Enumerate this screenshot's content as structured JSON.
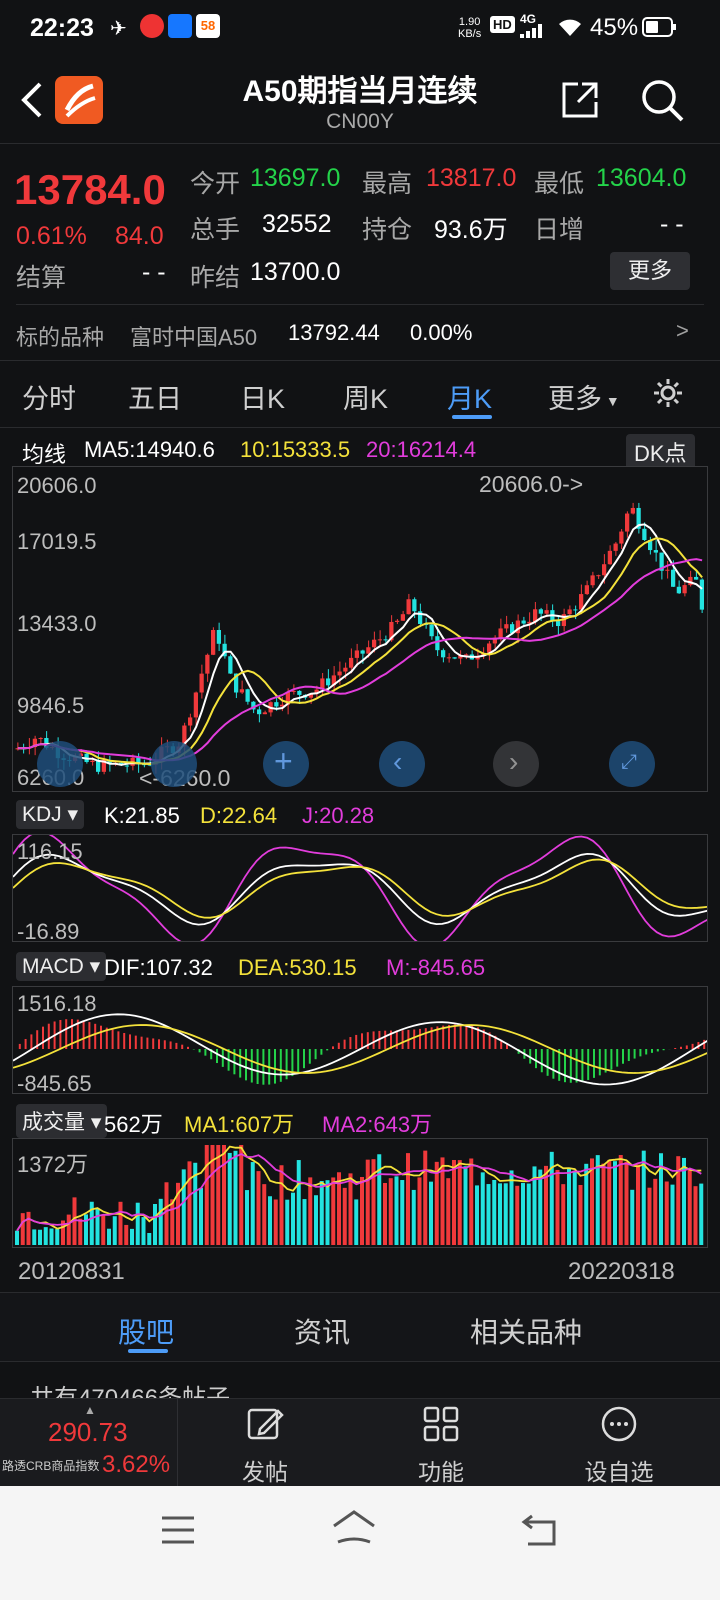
{
  "status": {
    "time": "22:23",
    "net_speed_top": "1.90",
    "net_speed_bottom": "KB/s",
    "hd": "HD",
    "signal": "4G",
    "battery": "45%",
    "app_badge": "58"
  },
  "header": {
    "title": "A50期指当月连续",
    "code": "CN00Y"
  },
  "quote": {
    "price": "13784.0",
    "change_pct": "0.61%",
    "change": "84.0",
    "open_label": "今开",
    "open": "13697.0",
    "high_label": "最高",
    "high": "13817.0",
    "low_label": "最低",
    "low": "13604.0",
    "volume_label": "总手",
    "volume": "32552",
    "oi_label": "持仓",
    "oi": "93.6万",
    "daily_inc_label": "日增",
    "daily_inc": "- -",
    "settle_label": "结算",
    "settle": "- -",
    "prev_settle_label": "昨结",
    "prev_settle": "13700.0",
    "more_button": "更多",
    "underlying_label": "标的品种",
    "underlying_name": "富时中国A50",
    "underlying_price": "13792.44",
    "underlying_pct": "0.00%"
  },
  "period_tabs": [
    "分时",
    "五日",
    "日K",
    "周K",
    "月K",
    "更多"
  ],
  "active_period": "月K",
  "kline": {
    "ma_label": "均线",
    "ma5": "MA5:14940.6",
    "ma10": "10:15333.5",
    "ma20": "20:16214.4",
    "dk_button": "DK点",
    "y_labels": [
      "20606.0",
      "17019.5",
      "13433.0",
      "9846.5",
      "6260.0"
    ],
    "high_marker": "20606.0->",
    "low_marker": "<-6260.0",
    "colors": {
      "up": "#f0393b",
      "down": "#23e3e0",
      "ma5": "#ffffff",
      "ma10": "#f4e23b",
      "ma20": "#e23ddc"
    }
  },
  "kdj": {
    "label": "KDJ",
    "k": "K:21.85",
    "d": "D:22.64",
    "j": "J:20.28",
    "y_top": "116.15",
    "y_bottom": "-16.89"
  },
  "macd": {
    "label": "MACD",
    "dif": "DIF:107.32",
    "dea": "DEA:530.15",
    "m": "M:-845.65",
    "y_top": "1516.18",
    "y_bottom": "-845.65"
  },
  "volume": {
    "label": "成交量",
    "value": "562万",
    "ma1": "MA1:607万",
    "ma2": "MA2:643万",
    "y_top": "1372万",
    "date_start": "20120831",
    "date_end": "20220318"
  },
  "bottom_tabs": [
    "股吧",
    "资讯",
    "相关品种"
  ],
  "post_count": "共有470466条帖子",
  "toolbar": {
    "index_value": "290.73",
    "index_name": "路透CRB商品指数",
    "index_pct": "3.62%",
    "post": "发帖",
    "function": "功能",
    "watchlist": "设自选"
  }
}
